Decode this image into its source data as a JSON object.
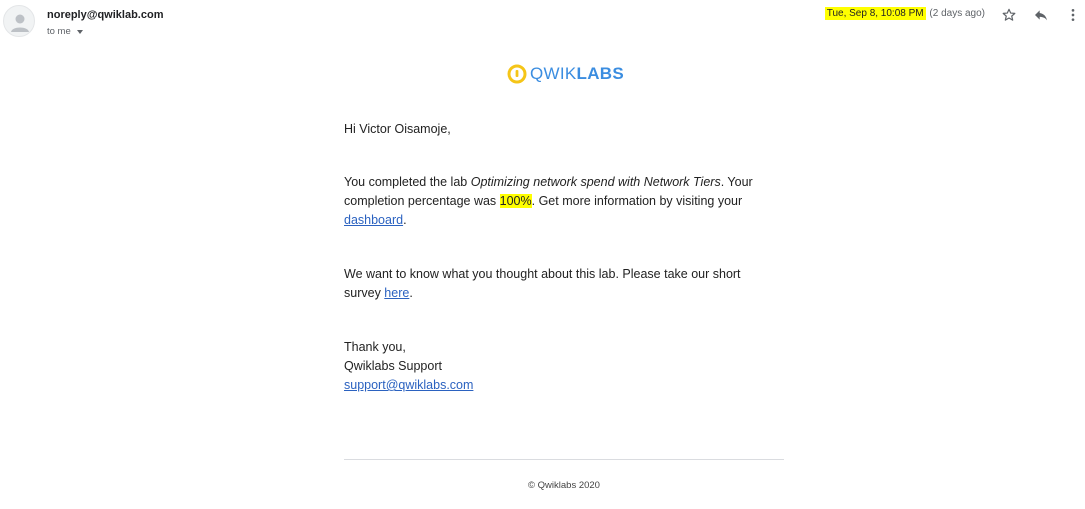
{
  "header": {
    "sender": "noreply@qwiklab.com",
    "recipient_label": "to me",
    "date": "Tue, Sep 8, 10:08 PM",
    "relative_date": "(2 days ago)"
  },
  "logo": {
    "text_thin": "QWIK",
    "text_bold": "LABS",
    "icon": "qwiklabs-logo-icon"
  },
  "email": {
    "greeting": "Hi Victor Oisamoje,",
    "completed": {
      "before_lab": "You completed the lab ",
      "lab_name": "Optimizing network spend with Network Tiers",
      "after_lab": ". Your completion percentage was ",
      "percentage": "100%",
      "after_percentage": ". Get more information by visiting your ",
      "dashboard_link": "dashboard",
      "end": "."
    },
    "survey": {
      "before_link": "We want to know what you thought about this lab. Please take our short survey ",
      "link": "here",
      "end": "."
    },
    "signoff": {
      "thanks": "Thank you,",
      "team": "Qwiklabs Support",
      "email": "support@qwiklabs.com"
    }
  },
  "footer": {
    "copyright": "© Qwiklabs 2020"
  },
  "icons": {
    "star": "star-icon",
    "reply": "reply-icon",
    "more": "more-vert-icon",
    "avatar": "person-icon"
  },
  "colors": {
    "highlight": "#ffff00",
    "link": "#2b62c0",
    "brand_blue": "#3b8de0",
    "brand_yellow": "#f5c518"
  }
}
